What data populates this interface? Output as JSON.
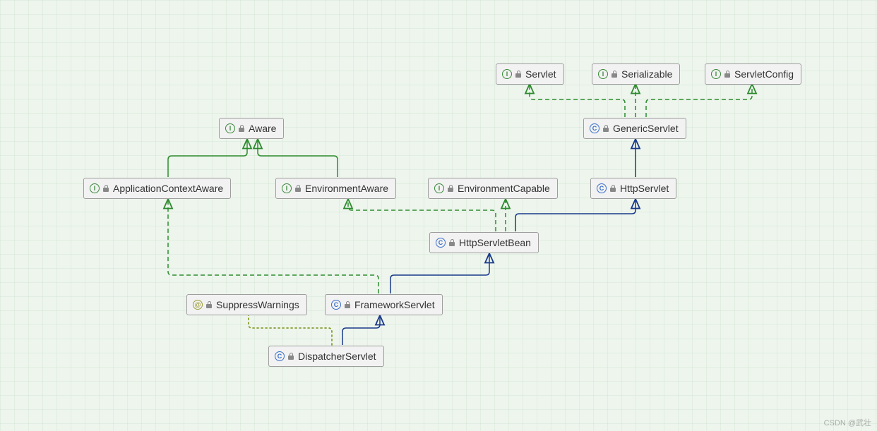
{
  "nodes": {
    "aware": {
      "label": "Aware",
      "type": "interface"
    },
    "appCtxAware": {
      "label": "ApplicationContextAware",
      "type": "interface"
    },
    "envAware": {
      "label": "EnvironmentAware",
      "type": "interface"
    },
    "envCapable": {
      "label": "EnvironmentCapable",
      "type": "interface"
    },
    "servlet": {
      "label": "Servlet",
      "type": "interface"
    },
    "serializable": {
      "label": "Serializable",
      "type": "interface"
    },
    "servletCfg": {
      "label": "ServletConfig",
      "type": "interface"
    },
    "genericSrv": {
      "label": "GenericServlet",
      "type": "class"
    },
    "httpSrv": {
      "label": "HttpServlet",
      "type": "class"
    },
    "httpSrvBean": {
      "label": "HttpServletBean",
      "type": "class"
    },
    "frameworkSrv": {
      "label": "FrameworkServlet",
      "type": "class"
    },
    "dispatcherSrv": {
      "label": "DispatcherServlet",
      "type": "class"
    },
    "suppressWarn": {
      "label": "SuppressWarnings",
      "type": "annotation"
    }
  },
  "watermark": "CSDN @武壮"
}
